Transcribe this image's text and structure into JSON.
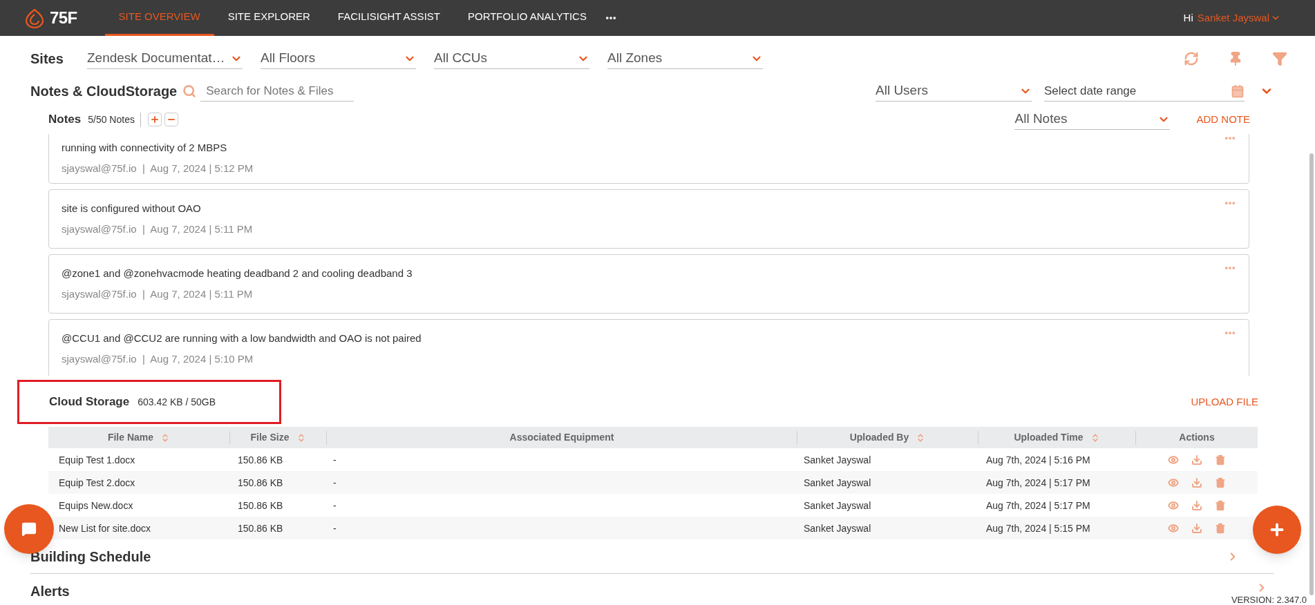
{
  "header": {
    "logo": "75F",
    "nav": [
      {
        "label": "SITE OVERVIEW",
        "selected": true
      },
      {
        "label": "SITE EXPLORER",
        "selected": false
      },
      {
        "label": "FACILISIGHT ASSIST",
        "selected": false
      },
      {
        "label": "PORTFOLIO ANALYTICS",
        "selected": false
      }
    ],
    "greeting": "Hi",
    "user": "Sanket Jayswal"
  },
  "filters": {
    "label": "Sites",
    "dropdowns": [
      "Zendesk Documentat…",
      "All Floors",
      "All CCUs",
      "All Zones"
    ]
  },
  "notes_section": {
    "title": "Notes & CloudStorage",
    "search": {
      "placeholder": "Search for Notes & Files"
    },
    "users_filter": "All Users",
    "date_filter": {
      "placeholder": "Select date range"
    }
  },
  "notes": {
    "title": "Notes",
    "count": "5/50 Notes",
    "filter": "All Notes",
    "add": "ADD NOTE",
    "items": [
      {
        "text": "running with connectivity of 2 MBPS",
        "meta": "sjayswal@75f.io  |  Aug 7, 2024 | 5:12 PM"
      },
      {
        "text": "site is configured without OAO",
        "meta": "sjayswal@75f.io  |  Aug 7, 2024 | 5:11 PM"
      },
      {
        "text": "@zone1 and @zonehvacmode heating deadband 2 and cooling deadband 3",
        "meta": "sjayswal@75f.io  |  Aug 7, 2024 | 5:11 PM"
      },
      {
        "text": "@CCU1 and @CCU2 are running with a low bandwidth and OAO is not paired",
        "meta": "sjayswal@75f.io  |  Aug 7, 2024 | 5:10 PM"
      }
    ]
  },
  "cloud_storage": {
    "title": "Cloud Storage",
    "usage": "603.42 KB / 50GB",
    "highlighted": true,
    "upload": "UPLOAD FILE",
    "columns": [
      {
        "label": "File Name",
        "sortable": true
      },
      {
        "label": "File Size",
        "sortable": true
      },
      {
        "label": "Associated Equipment",
        "sortable": false
      },
      {
        "label": "Uploaded By",
        "sortable": true
      },
      {
        "label": "Uploaded Time",
        "sortable": true
      },
      {
        "label": "Actions",
        "sortable": false
      }
    ],
    "rows": [
      [
        "Equip Test 1.docx",
        "150.86 KB",
        "-",
        "Sanket Jayswal",
        "Aug 7th, 2024 | 5:16 PM"
      ],
      [
        "Equip Test 2.docx",
        "150.86 KB",
        "-",
        "Sanket Jayswal",
        "Aug 7th, 2024 | 5:17 PM"
      ],
      [
        "Equips New.docx",
        "150.86 KB",
        "-",
        "Sanket Jayswal",
        "Aug 7th, 2024 | 5:17 PM"
      ],
      [
        "New List for site.docx",
        "150.86 KB",
        "-",
        "Sanket Jayswal",
        "Aug 7th, 2024 | 5:15 PM"
      ]
    ]
  },
  "sections": [
    "Building Schedule",
    "Alerts"
  ],
  "version": "VERSION: 2.347.0"
}
